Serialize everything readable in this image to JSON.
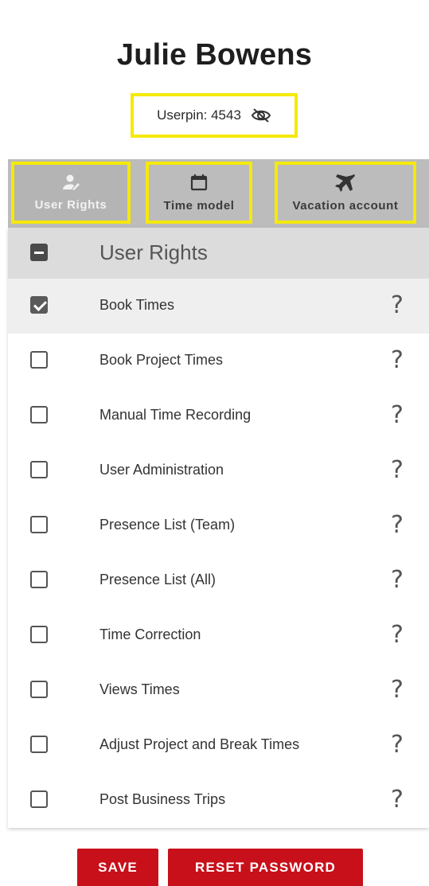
{
  "user": {
    "name": "Julie Bowens",
    "pin_label": "Userpin: 4543",
    "pin_toggle_icon": "eye-off-icon"
  },
  "tabs": [
    {
      "label": "User Rights",
      "icon": "user-edit-icon",
      "active": true
    },
    {
      "label": "Time model",
      "icon": "calendar-icon",
      "active": false
    },
    {
      "label": "Vacation account",
      "icon": "airplane-icon",
      "active": false
    }
  ],
  "rights": {
    "header": "User Rights",
    "items": [
      {
        "label": "Book Times",
        "checked": true
      },
      {
        "label": "Book Project Times",
        "checked": false
      },
      {
        "label": "Manual Time Recording",
        "checked": false
      },
      {
        "label": "User Administration",
        "checked": false
      },
      {
        "label": "Presence List (Team)",
        "checked": false
      },
      {
        "label": "Presence List (All)",
        "checked": false
      },
      {
        "label": "Time Correction",
        "checked": false
      },
      {
        "label": "Views Times",
        "checked": false
      },
      {
        "label": "Adjust Project and Break Times",
        "checked": false
      },
      {
        "label": "Post Business Trips",
        "checked": false
      }
    ],
    "help_symbol": "?"
  },
  "actions": {
    "save_label": "SAVE",
    "reset_label": "RESET PASSWORD"
  },
  "colors": {
    "highlight": "#f5e90a",
    "primary": "#c8101a",
    "tabbar": "#bcbcbc"
  }
}
